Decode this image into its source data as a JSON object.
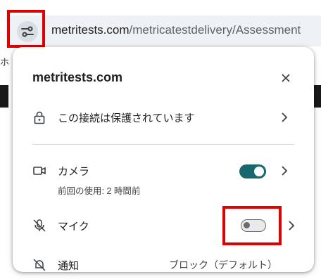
{
  "omnibox": {
    "host": "metritests.com",
    "path": "/metricatestdelivery/Assessment",
    "tune_icon": "tune-icon"
  },
  "background": {
    "fragment": "ホ"
  },
  "popup": {
    "title": "metritests.com",
    "close_icon": "close-icon",
    "connection": {
      "label": "この接続は保護されています",
      "icon": "lock-icon"
    },
    "permissions": [
      {
        "label": "カメラ",
        "sublabel": "前回の使用: 2 時間前",
        "icon": "camera-icon",
        "enabled": true
      },
      {
        "label": "マイク",
        "icon": "mic-off-icon",
        "enabled": false
      },
      {
        "label": "通知",
        "value": "ブロック（デフォルト）",
        "icon": "notifications-off-icon"
      }
    ]
  },
  "colors": {
    "accent": "#16686e",
    "highlight": "#e00000",
    "divider": "#b6e5e2"
  }
}
